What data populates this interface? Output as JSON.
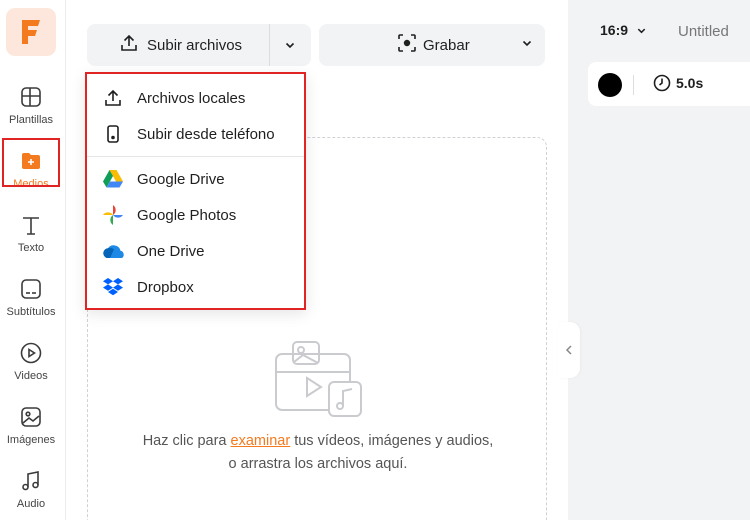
{
  "sidebar": {
    "items": [
      {
        "label": "Plantillas",
        "icon": "layout-icon"
      },
      {
        "label": "Medios",
        "icon": "folder-plus-icon",
        "active": true
      },
      {
        "label": "Texto",
        "icon": "text-icon"
      },
      {
        "label": "Subtítulos",
        "icon": "subtitles-icon"
      },
      {
        "label": "Videos",
        "icon": "play-circle-icon"
      },
      {
        "label": "Imágenes",
        "icon": "image-icon"
      },
      {
        "label": "Audio",
        "icon": "music-note-icon"
      }
    ]
  },
  "toolbar": {
    "upload_label": "Subir archivos",
    "record_label": "Grabar"
  },
  "upload_menu": {
    "items": [
      {
        "label": "Archivos locales",
        "icon": "upload-icon"
      },
      {
        "label": "Subir desde teléfono",
        "icon": "phone-icon"
      },
      {
        "label": "Google Drive",
        "icon": "google-drive-icon"
      },
      {
        "label": "Google Photos",
        "icon": "google-photos-icon"
      },
      {
        "label": "One Drive",
        "icon": "onedrive-icon"
      },
      {
        "label": "Dropbox",
        "icon": "dropbox-icon"
      }
    ]
  },
  "dropzone": {
    "prefix": "Haz clic para ",
    "link": "examinar",
    "suffix": " tus vídeos, imágenes y audios,",
    "line2": "o arrastra los archivos aquí."
  },
  "canvas": {
    "aspect_ratio": "16:9",
    "project_title": "Untitled",
    "duration": "5.0s",
    "background_color": "#000000"
  },
  "colors": {
    "accent": "#f47a20",
    "highlight_border": "#e02424"
  }
}
